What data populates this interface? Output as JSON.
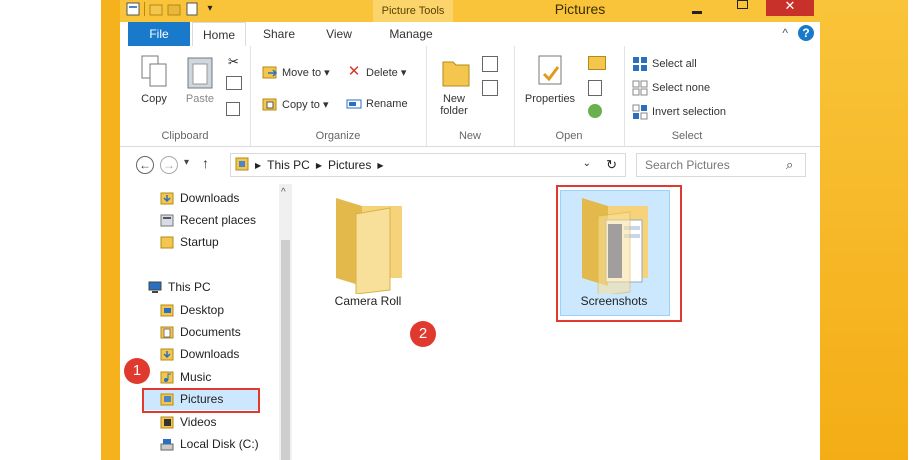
{
  "window": {
    "title": "Pictures",
    "context_tab": "Picture Tools",
    "close_glyph": "✕"
  },
  "ribbon_tabs": [
    "File",
    "Home",
    "Share",
    "View",
    "Manage"
  ],
  "ribbon": {
    "clipboard": {
      "label": "Clipboard",
      "copy": "Copy",
      "paste": "Paste"
    },
    "organize": {
      "label": "Organize",
      "move_to": "Move to ▾",
      "delete": "Delete ▾",
      "copy_to": "Copy to ▾",
      "rename": "Rename"
    },
    "new": {
      "label": "New",
      "new_folder": "New folder"
    },
    "open": {
      "label": "Open",
      "properties": "Properties"
    },
    "select": {
      "label": "Select",
      "select_all": "Select all",
      "select_none": "Select none",
      "invert": "Invert selection"
    }
  },
  "address": {
    "path": [
      "This PC",
      "Pictures"
    ],
    "search_placeholder": "Search Pictures"
  },
  "nav_pane": {
    "items": [
      "Downloads",
      "Recent places",
      "Startup",
      "This PC",
      "Desktop",
      "Documents",
      "Downloads",
      "Music",
      "Pictures",
      "Videos",
      "Local Disk (C:)"
    ],
    "selected": "Pictures"
  },
  "content": {
    "folders": [
      "Camera Roll",
      "Screenshots"
    ],
    "selected": "Screenshots"
  },
  "annotations": {
    "badge1": "1",
    "badge2": "2",
    "color": "#e03a2f"
  },
  "colors": {
    "background_orange": "#f6b21c",
    "titlebar": "#f9c43a",
    "file_tab": "#1979ca",
    "selection": "#cce8ff"
  }
}
